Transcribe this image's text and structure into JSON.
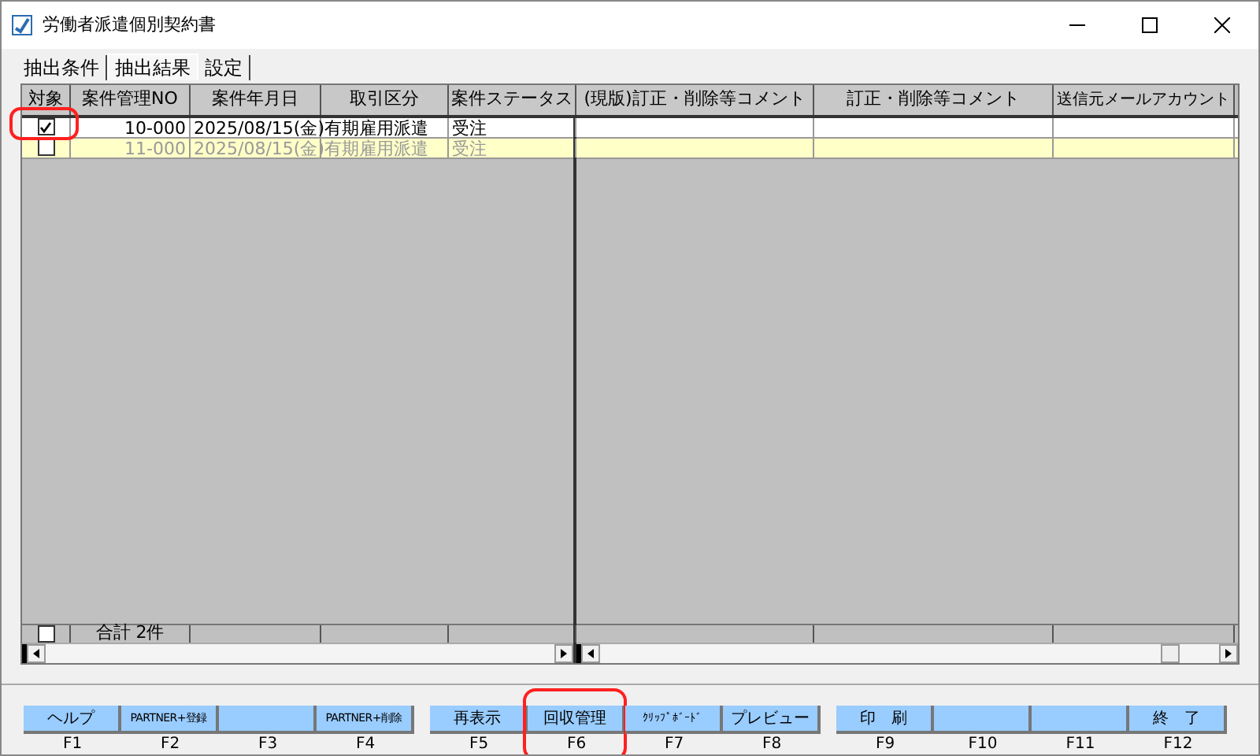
{
  "window": {
    "title": "労働者派遣個別契約書"
  },
  "tabs": [
    {
      "label": "抽出条件",
      "selected": false
    },
    {
      "label": "抽出結果",
      "selected": true
    },
    {
      "label": "設定",
      "selected": false
    }
  ],
  "table": {
    "left_columns": [
      "対象",
      "案件管理NO",
      "案件年月日",
      "取引区分",
      "案件ステータス"
    ],
    "right_columns": [
      "(現版)訂正・削除等コメント",
      "訂正・削除等コメント",
      "送信元メールアカウント"
    ],
    "rows": [
      {
        "checked": true,
        "highlighted": false,
        "circled": true,
        "cells": [
          "10-000",
          "2025/08/15(金)",
          "有期雇用派遣",
          "受注"
        ]
      },
      {
        "checked": false,
        "highlighted": true,
        "circled": false,
        "cells": [
          "11-000",
          "2025/08/15(金)",
          "有期雇用派遣",
          "受注"
        ]
      }
    ],
    "footer": {
      "checked": false,
      "total": "合計 2件"
    }
  },
  "function_keys": [
    {
      "label": "ヘルプ",
      "key": "F1",
      "circled": false
    },
    {
      "label": "PARTNER+登録",
      "key": "F2",
      "circled": false
    },
    {
      "key": "F3",
      "circled": false
    },
    {
      "label": "PARTNER+削除",
      "key": "F4",
      "circled": false
    },
    {
      "label": "再表示",
      "key": "F5",
      "circled": false
    },
    {
      "label": "回収管理",
      "key": "F6",
      "circled": true
    },
    {
      "label": "ｸﾘｯﾌﾟﾎﾞｰﾄﾞ",
      "key": "F7",
      "circled": false
    },
    {
      "label": "プレビュー",
      "key": "F8",
      "circled": false
    },
    {
      "label": "印　刷",
      "key": "F9",
      "circled": false
    },
    {
      "key": "F10",
      "circled": false
    },
    {
      "key": "F11",
      "circled": false
    },
    {
      "label": "終　了",
      "key": "F12",
      "circled": false
    }
  ]
}
